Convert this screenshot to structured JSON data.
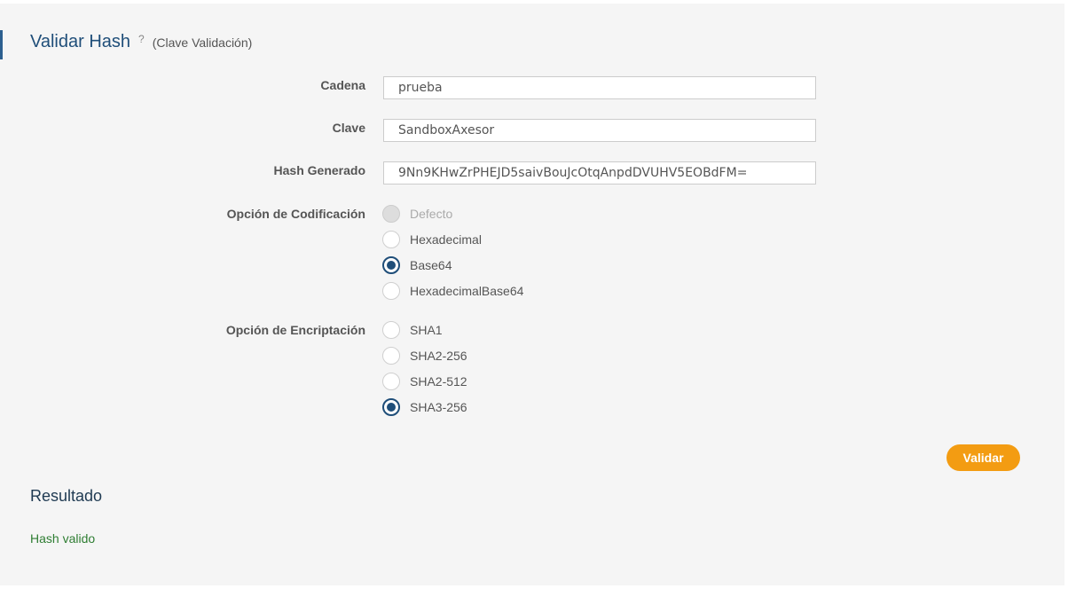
{
  "header": {
    "title": "Validar Hash",
    "help_mark": "?",
    "subtitle": "(Clave Validación)"
  },
  "form": {
    "cadena": {
      "label": "Cadena",
      "value": "prueba"
    },
    "clave": {
      "label": "Clave",
      "value": "SandboxAxesor"
    },
    "hash": {
      "label": "Hash Generado",
      "value": "9Nn9KHwZrPHEJD5saivBouJcOtqAnpdDVUHV5EOBdFM="
    },
    "codificacion": {
      "label": "Opción de Codificación",
      "options": [
        {
          "label": "Defecto",
          "state": "disabled"
        },
        {
          "label": "Hexadecimal",
          "state": "unchecked"
        },
        {
          "label": "Base64",
          "state": "checked"
        },
        {
          "label": "HexadecimalBase64",
          "state": "unchecked"
        }
      ]
    },
    "encriptacion": {
      "label": "Opción de Encriptación",
      "options": [
        {
          "label": "SHA1",
          "state": "unchecked"
        },
        {
          "label": "SHA2-256",
          "state": "unchecked"
        },
        {
          "label": "SHA2-512",
          "state": "unchecked"
        },
        {
          "label": "SHA3-256",
          "state": "checked"
        }
      ]
    },
    "submit_label": "Validar"
  },
  "result": {
    "title": "Resultado",
    "message": "Hash valido"
  },
  "colors": {
    "accent": "#1f4e79",
    "button": "#f39c12",
    "success": "#2e7d32"
  }
}
